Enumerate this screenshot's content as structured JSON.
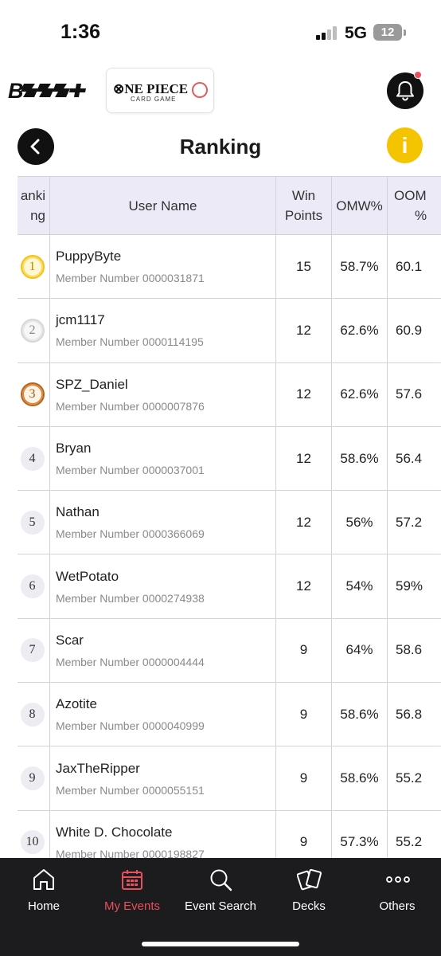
{
  "status_bar": {
    "time": "1:36",
    "network": "5G",
    "battery": "12"
  },
  "header": {
    "brand_logo": "B✉✉✉+",
    "game_logo_title": "⊗NE PIECE",
    "game_logo_subtitle": "CARD GAME",
    "notification_icon": "bell-icon",
    "notification_dot_color": "#e8505b"
  },
  "page": {
    "title": "Ranking",
    "back_icon": "chevron-left-icon",
    "info_label": "i",
    "info_color": "#f5c400"
  },
  "table": {
    "headers": {
      "ranking_line1": "anki",
      "ranking_line2": "ng",
      "user_name": "User Name",
      "win_line1": "Win",
      "win_line2": "Points",
      "omw": "OMW%",
      "oomw_line1": "OOM",
      "oomw_line2": "%"
    },
    "rows": [
      {
        "rank": "1",
        "medal": "gold",
        "name": "PuppyByte",
        "member": "Member Number 0000031871",
        "win_points": "15",
        "omw": "58.7%",
        "oomw": "60.1"
      },
      {
        "rank": "2",
        "medal": "silver",
        "name": "jcm1117",
        "member": "Member Number 0000114195",
        "win_points": "12",
        "omw": "62.6%",
        "oomw": "60.9"
      },
      {
        "rank": "3",
        "medal": "bronze",
        "name": "SPZ_Daniel",
        "member": "Member Number 0000007876",
        "win_points": "12",
        "omw": "62.6%",
        "oomw": "57.6"
      },
      {
        "rank": "4",
        "medal": "plain",
        "name": "Bryan",
        "member": "Member Number 0000037001",
        "win_points": "12",
        "omw": "58.6%",
        "oomw": "56.4"
      },
      {
        "rank": "5",
        "medal": "plain",
        "name": "Nathan",
        "member": "Member Number 0000366069",
        "win_points": "12",
        "omw": "56%",
        "oomw": "57.2"
      },
      {
        "rank": "6",
        "medal": "plain",
        "name": "WetPotato",
        "member": "Member Number 0000274938",
        "win_points": "12",
        "omw": "54%",
        "oomw": "59%"
      },
      {
        "rank": "7",
        "medal": "plain",
        "name": "Scar",
        "member": "Member Number 0000004444",
        "win_points": "9",
        "omw": "64%",
        "oomw": "58.6"
      },
      {
        "rank": "8",
        "medal": "plain",
        "name": "Azotite",
        "member": "Member Number 0000040999",
        "win_points": "9",
        "omw": "58.6%",
        "oomw": "56.8"
      },
      {
        "rank": "9",
        "medal": "plain",
        "name": "JaxTheRipper",
        "member": "Member Number 0000055151",
        "win_points": "9",
        "omw": "58.6%",
        "oomw": "55.2"
      },
      {
        "rank": "10",
        "medal": "plain",
        "name": "White D. Chocolate",
        "member": "Member Number 0000198827",
        "win_points": "9",
        "omw": "57.3%",
        "oomw": "55.2"
      }
    ]
  },
  "bottom_nav": {
    "active_color": "#e8505b",
    "items": [
      {
        "label": "Home",
        "icon": "home-icon"
      },
      {
        "label": "My Events",
        "icon": "calendar-icon"
      },
      {
        "label": "Event Search",
        "icon": "search-icon"
      },
      {
        "label": "Decks",
        "icon": "cards-icon"
      },
      {
        "label": "Others",
        "icon": "more-icon"
      }
    ]
  }
}
